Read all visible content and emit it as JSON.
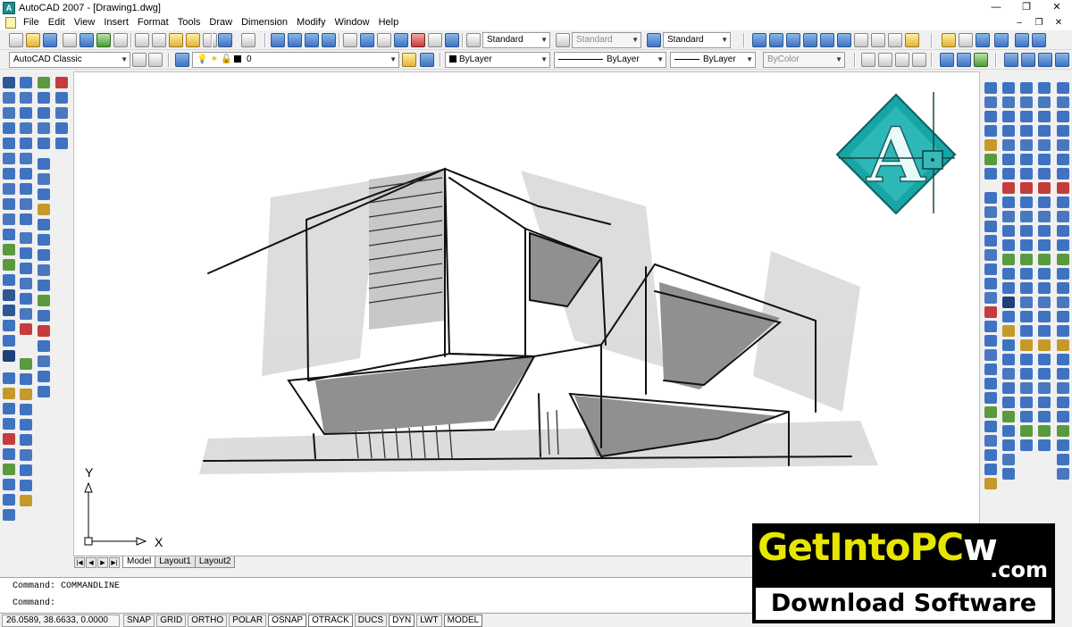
{
  "window": {
    "title": "AutoCAD 2007 - [Drawing1.dwg]",
    "app_icon": "A",
    "controls": [
      "—",
      "❐",
      "✕"
    ]
  },
  "menu": {
    "items": [
      "File",
      "Edit",
      "View",
      "Insert",
      "Format",
      "Tools",
      "Draw",
      "Dimension",
      "Modify",
      "Window",
      "Help"
    ],
    "mdi_controls": [
      "–",
      "❐",
      "✕"
    ]
  },
  "toolbar1": {
    "text_style": "Standard",
    "dim_style": "Standard",
    "table_style": "Standard"
  },
  "toolbar2": {
    "workspace": "AutoCAD Classic",
    "layer": "0",
    "color": "ByLayer",
    "linetype": "ByLayer",
    "lineweight": "ByLayer",
    "plot_style": "ByColor"
  },
  "ucs": {
    "x_label": "X",
    "y_label": "Y"
  },
  "layout_tabs": {
    "nav": [
      "|◀",
      "◀",
      "▶",
      "▶|"
    ],
    "tabs": [
      "Model",
      "Layout1",
      "Layout2"
    ],
    "active": "Model"
  },
  "command": {
    "history": "Command: COMMANDLINE",
    "prompt": "Command:"
  },
  "status": {
    "coordinates": "26.0589, 38.6633, 0.0000",
    "buttons": [
      "SNAP",
      "GRID",
      "ORTHO",
      "POLAR",
      "OSNAP",
      "OTRACK",
      "DUCS",
      "DYN",
      "LWT",
      "MODEL"
    ],
    "on": [
      "OSNAP",
      "OTRACK",
      "DYN",
      "MODEL"
    ]
  },
  "watermark": {
    "brand_part1": "GetIntoPC",
    "brand_part2": "w",
    "domain": ".com",
    "tagline": "Download Software"
  },
  "logo": {
    "letter": "A",
    "accent": "#17a5a5"
  }
}
